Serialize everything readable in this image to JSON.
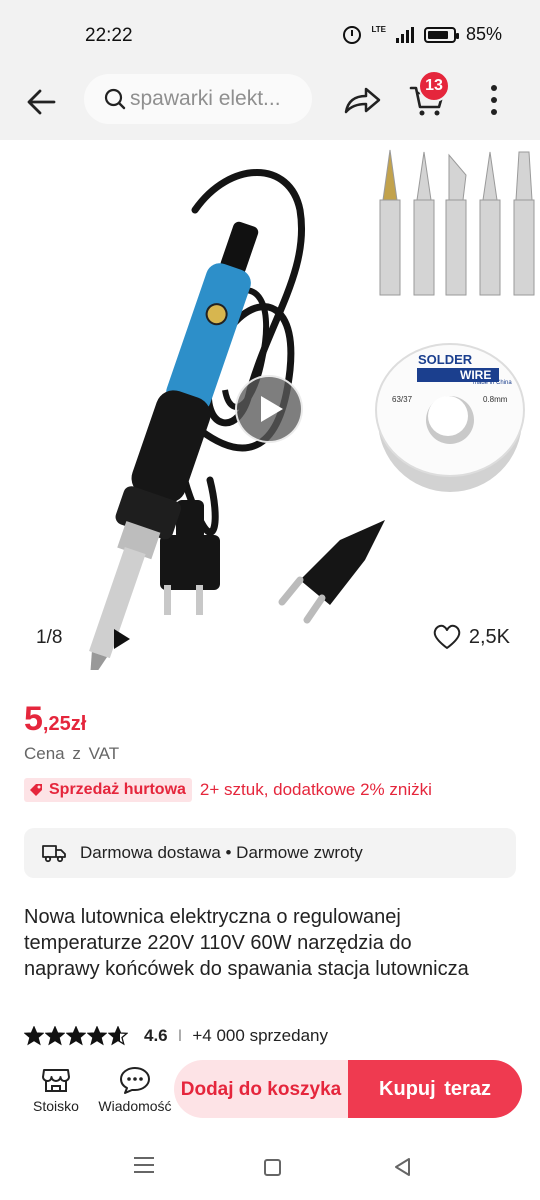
{
  "status": {
    "time": "22:22",
    "battery": "85%",
    "network": "LTE",
    "battery_level": 0.85
  },
  "search": {
    "placeholder": "spawarki elekt..."
  },
  "cart": {
    "count": "13"
  },
  "gallery": {
    "counter": "1/8",
    "likes": "2,5K",
    "solder_label_top": "SOLDER",
    "solder_label_bottom": "WIRE",
    "solder_small_left": "63/37",
    "solder_small_right": "0.8mm",
    "solder_made": "made in China"
  },
  "price": {
    "integer": "5",
    "rest": ",25zł",
    "vat_note": "Cena z VAT",
    "color": "#e5263c"
  },
  "wholesale": {
    "badge": "Sprzedaż hurtowa",
    "text": "2+ sztuk, dodatkowe 2% zniżki"
  },
  "delivery": {
    "text": "Darmowa dostawa • Darmowe zwroty"
  },
  "product": {
    "title": "Nowa lutownica elektryczna o regulowanej temperaturze 220V 110V 60W narzędzia do naprawy końcówek do spawania stacja lutownicza"
  },
  "rating": {
    "score": "4.6",
    "separator": "I",
    "sold": "+4 000 sprzedany",
    "stars": 4.6
  },
  "bottom": {
    "store": "Stoisko",
    "messages": "Wiadomość",
    "add_to_cart": "Dodaj do koszyka",
    "buy_now": "Kupuj teraz"
  }
}
